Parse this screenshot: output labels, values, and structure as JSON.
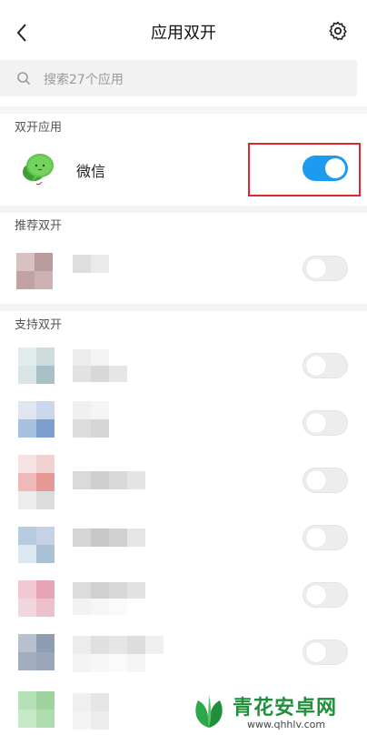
{
  "header": {
    "title": "应用双开"
  },
  "search": {
    "placeholder": "搜索27个应用"
  },
  "sections": {
    "dual": "双开应用",
    "recommended": "推荐双开",
    "supported": "支持双开"
  },
  "dual_apps": [
    {
      "name": "微信",
      "enabled": true
    }
  ],
  "recommended_apps": [
    {
      "name": "",
      "enabled": false
    }
  ],
  "supported_apps": [
    {
      "name": "",
      "enabled": false
    },
    {
      "name": "",
      "enabled": false
    },
    {
      "name": "",
      "enabled": false
    },
    {
      "name": "",
      "enabled": false
    },
    {
      "name": "",
      "enabled": false
    },
    {
      "name": "",
      "enabled": false
    }
  ],
  "colors": {
    "toggle_on": "#1d9bf0",
    "highlight": "#e0262a",
    "watermark": "#1f8f3a"
  },
  "watermark": {
    "title": "青花安卓网",
    "url": "www.qhhlv.com"
  }
}
